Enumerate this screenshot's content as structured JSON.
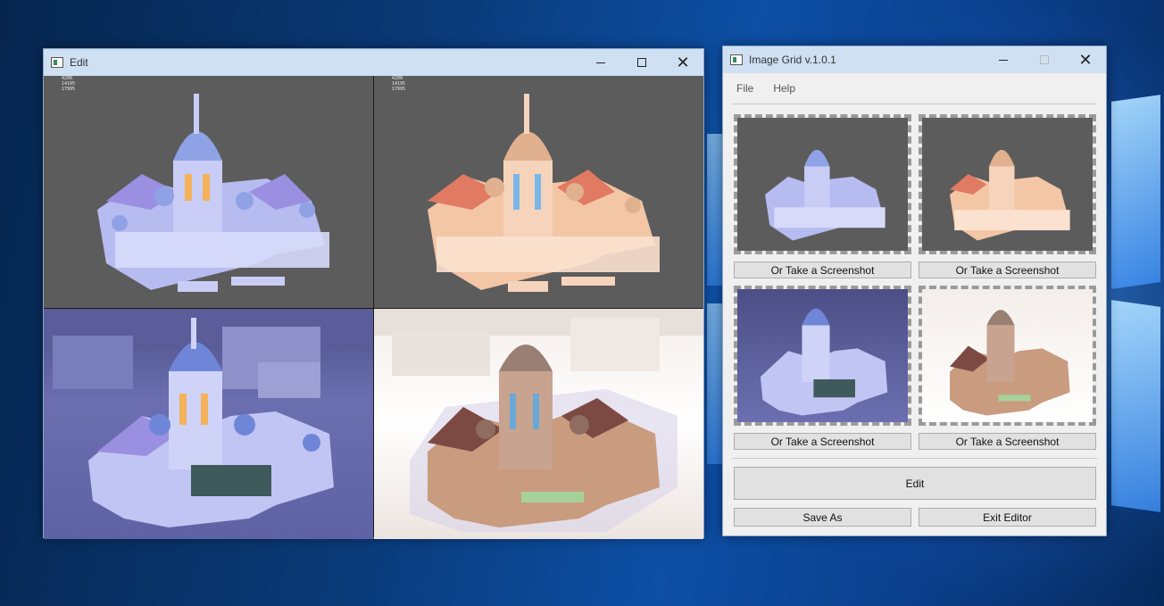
{
  "edit_window": {
    "title": "Edit",
    "quadrants": [
      {
        "id": "top-left",
        "style": "gray",
        "stats": [
          "4200",
          "14195",
          "17995"
        ]
      },
      {
        "id": "top-right",
        "style": "gray",
        "stats": [
          "4200",
          "14195",
          "17995"
        ]
      },
      {
        "id": "bottom-left",
        "style": "blue-map"
      },
      {
        "id": "bottom-right",
        "style": "white-map"
      }
    ]
  },
  "grid_window": {
    "title": "Image Grid v.1.0.1",
    "menu": [
      "File",
      "Help"
    ],
    "screenshot_label": "Or Take a Screenshot",
    "edit_label": "Edit",
    "save_as_label": "Save As",
    "exit_label": "Exit Editor"
  },
  "colors": {
    "titlebar": "#cfe0f3",
    "button_bg": "#e1e1e1",
    "viewport_gray": "#5c5c5c",
    "desktop_blue": "#0d4fa5"
  }
}
